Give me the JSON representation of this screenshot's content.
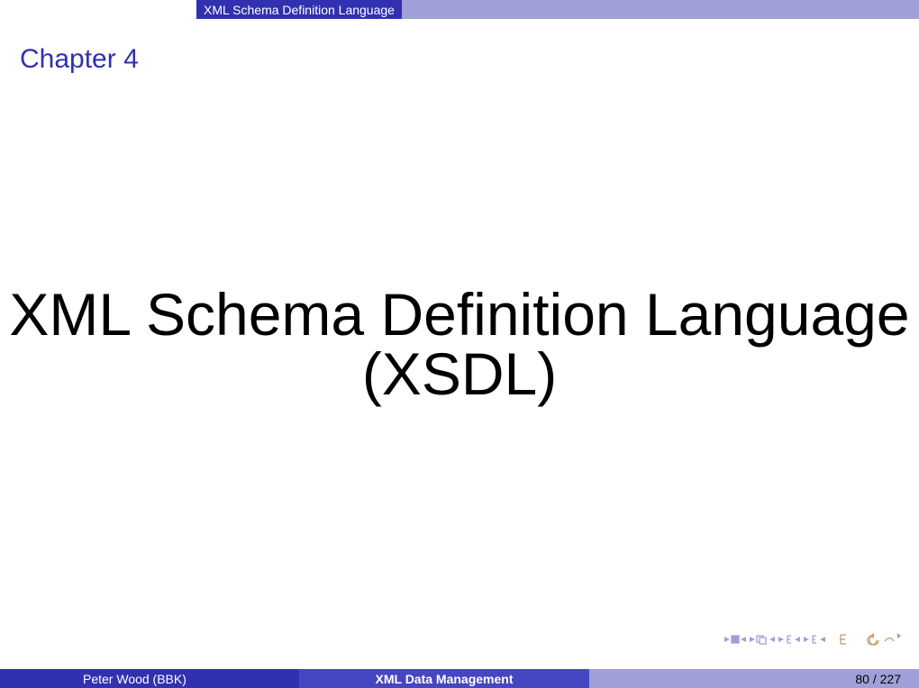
{
  "header": {
    "section_label": "XML Schema Definition Language"
  },
  "body": {
    "chapter_label": "Chapter 4",
    "main_title": "XML Schema Definition Language (XSDL)"
  },
  "footer": {
    "author": "Peter Wood  (BBK)",
    "course": "XML Data Management",
    "page": "80 / 227"
  }
}
